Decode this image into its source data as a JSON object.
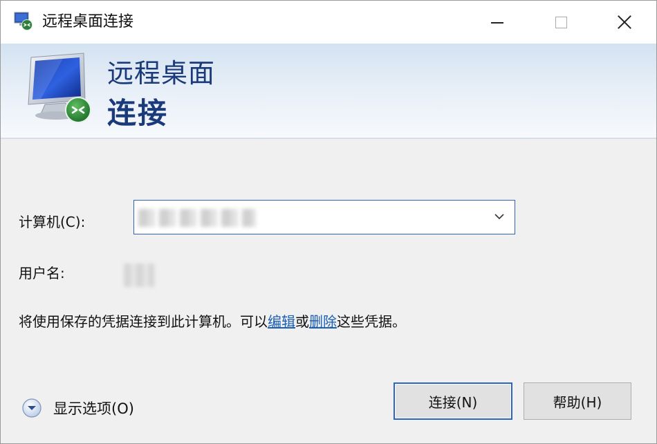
{
  "window": {
    "title": "远程桌面连接",
    "controls": {
      "minimize": "minimize-icon",
      "maximize": "maximize-icon",
      "close": "close-icon"
    }
  },
  "banner": {
    "title_line1": "远程桌面",
    "title_line2": "连接",
    "icon": "remote-desktop-monitor-icon"
  },
  "form": {
    "computer_label": "计算机(C):",
    "computer_value_blurred": true,
    "username_label": "用户名:",
    "username_value_blurred": true
  },
  "info": {
    "prefix": "将使用保存的凭据连接到此计算机。可以",
    "edit_link": "编辑",
    "middle": "或",
    "delete_link": "删除",
    "suffix": "这些凭据。"
  },
  "options": {
    "label": "显示选项(O)",
    "icon": "expand-chevron-icon"
  },
  "buttons": {
    "connect": "连接(N)",
    "help": "帮助(H)"
  },
  "colors": {
    "banner_title": "#1a3a7a",
    "link": "#1a5fb4",
    "focus_border": "#2b64c0",
    "window_bg": "#f0f0f0"
  }
}
